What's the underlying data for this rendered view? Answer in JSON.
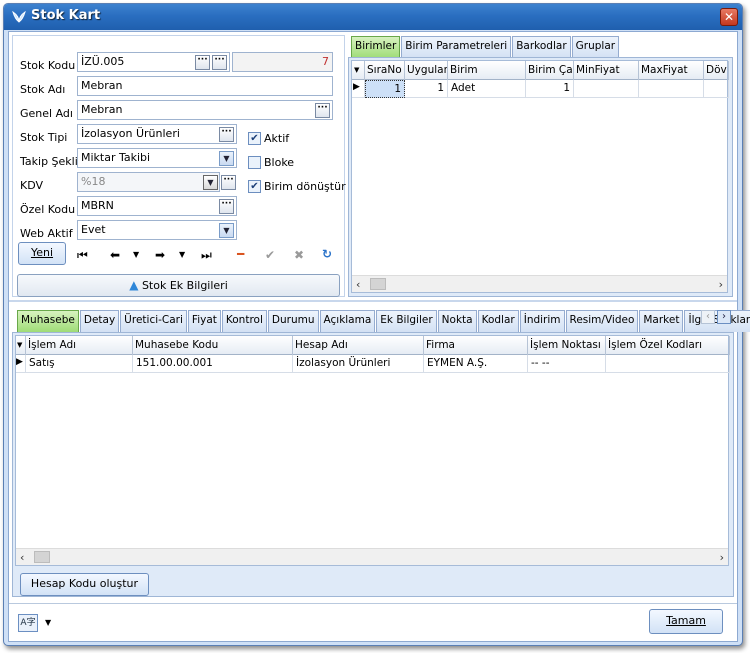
{
  "window": {
    "title": "Stok Kart",
    "close": "✕"
  },
  "form": {
    "stok_kodu": {
      "label": "Stok Kodu",
      "value": "İZÜ.005",
      "counter": "7"
    },
    "stok_adi": {
      "label": "Stok Adı",
      "value": "Mebran"
    },
    "genel_adi": {
      "label": "Genel Adı",
      "value": "Mebran"
    },
    "stok_tipi": {
      "label": "Stok Tipi",
      "value": "İzolasyon Ürünleri"
    },
    "takip_sekli": {
      "label": "Takip Şekli",
      "value": "Miktar Takibi"
    },
    "kdv": {
      "label": "KDV",
      "value": "%18"
    },
    "ozel_kodu": {
      "label": "Özel Kodu",
      "value": "MBRN"
    },
    "web_aktif": {
      "label": "Web Aktif",
      "value": "Evet"
    },
    "ellipsis": "···"
  },
  "checks": {
    "aktif": {
      "label": "Aktif",
      "checked": true
    },
    "bloke": {
      "label": "Bloke",
      "checked": false
    },
    "birim_donustur": {
      "label": "Birim dönüştür",
      "checked": true
    }
  },
  "buttons": {
    "yeni": "Yeni",
    "stok_ek": "Stok Ek Bilgileri",
    "hesap_kodu": "Hesap Kodu oluştur",
    "tamam": "Tamam"
  },
  "unit_tabs": [
    "Birimler",
    "Birim Parametreleri",
    "Barkodlar",
    "Gruplar"
  ],
  "unit_grid": {
    "headers": [
      "SıraNo",
      "Uygulam",
      "Birim",
      "Birim Çarp",
      "MinFiyat",
      "MaxFiyat",
      "Döv"
    ],
    "rows": [
      [
        "1",
        "1",
        "Adet",
        "1",
        "",
        "",
        ""
      ]
    ]
  },
  "bottom_tabs": [
    "Muhasebe",
    "Detay",
    "Üretici-Cari",
    "Fiyat",
    "Kontrol",
    "Durumu",
    "Açıklama",
    "Ek Bilgiler",
    "Nokta",
    "Kodlar",
    "İndirim",
    "Resim/Video",
    "Market",
    "İlgili Stoklar"
  ],
  "acc_grid": {
    "headers": [
      "İşlem Adı",
      "Muhasebe Kodu",
      "Hesap Adı",
      "Firma",
      "İşlem Noktası",
      "İşlem Özel Kodları"
    ],
    "rows": [
      [
        "Satış",
        "151.00.00.001",
        "İzolasyon Ürünleri",
        "EYMEN A.Ş.",
        "-- --",
        ""
      ]
    ]
  },
  "icons": {
    "first": "first-record-icon",
    "prev": "prev-record-icon",
    "next": "next-record-icon",
    "last": "last-record-icon",
    "delete": "delete-icon",
    "save": "save-check-icon",
    "cancel": "cancel-icon",
    "refresh": "refresh-icon",
    "translate": "language-icon"
  },
  "colors": {
    "accent_tab": "#9fdc77",
    "title_bar": "#2a6ec0",
    "delete": "#d9531e",
    "refresh": "#2b73c9"
  }
}
